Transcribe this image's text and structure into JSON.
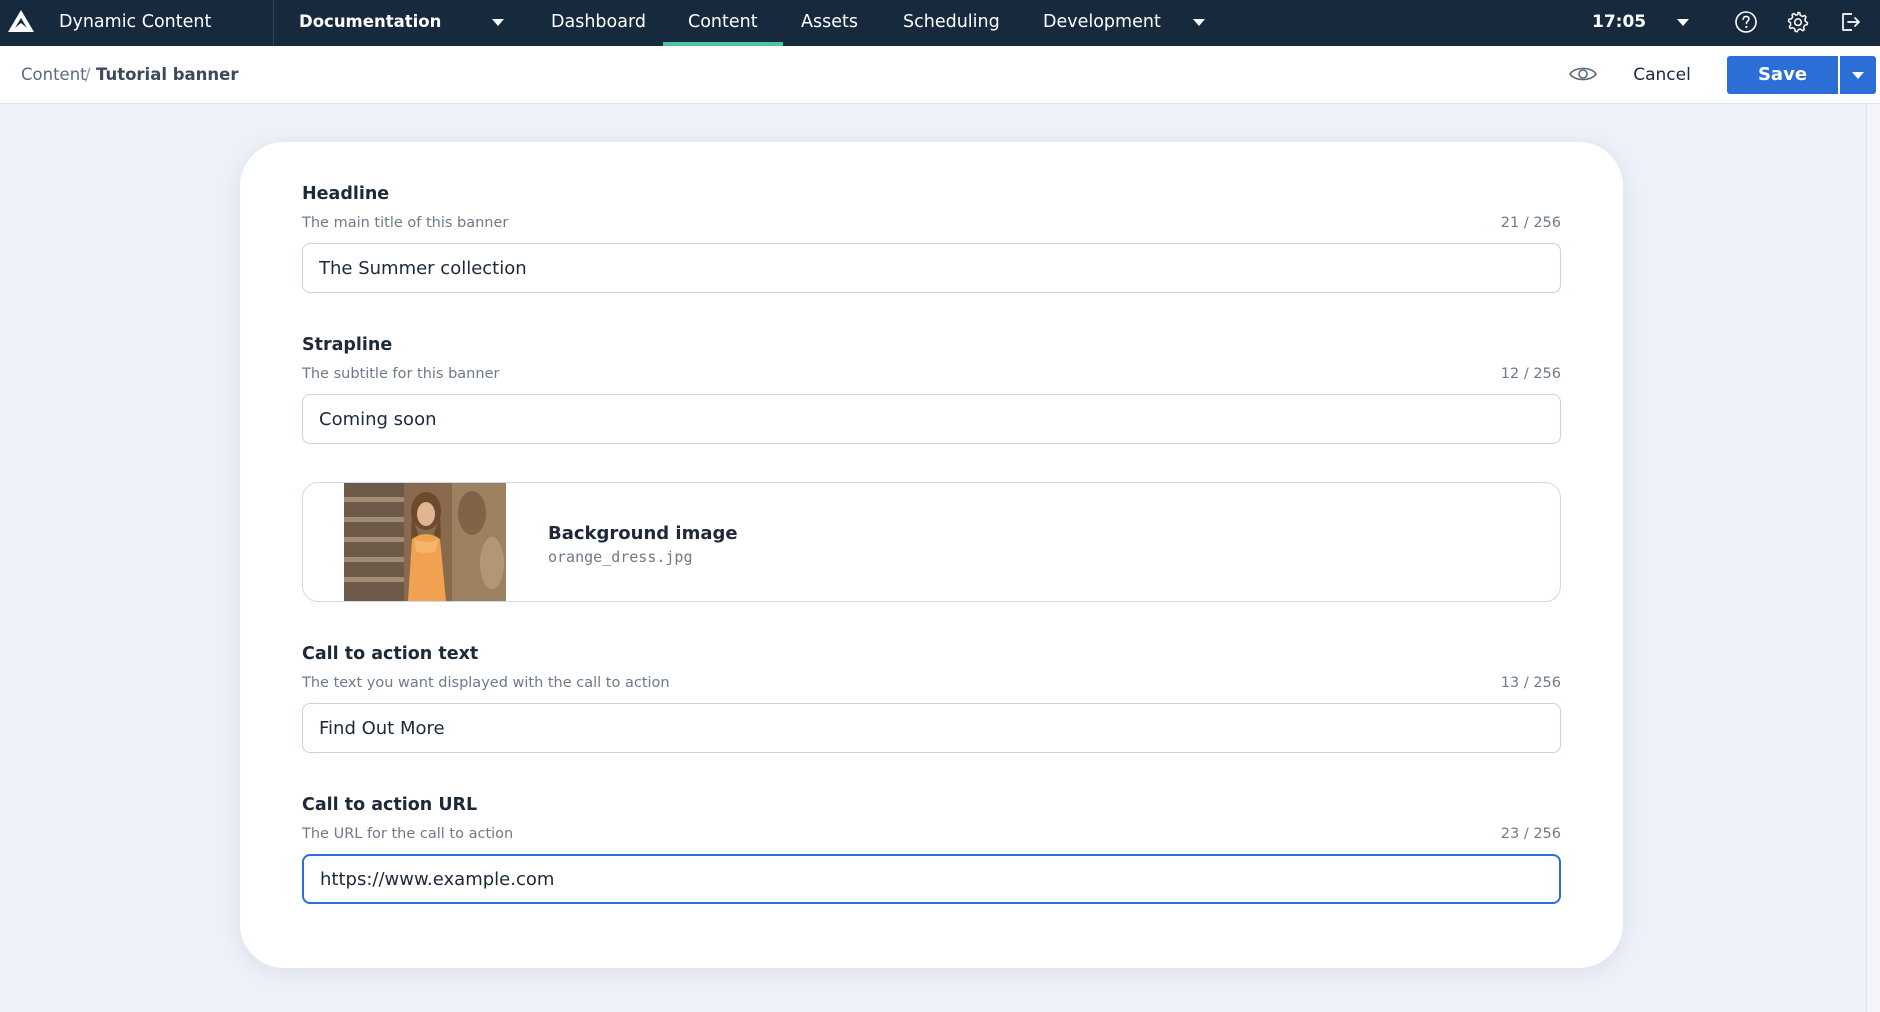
{
  "app": {
    "name": "Dynamic Content"
  },
  "hub": {
    "label": "Documentation"
  },
  "nav": {
    "items": [
      {
        "label": "Dashboard",
        "active": false
      },
      {
        "label": "Content",
        "active": true
      },
      {
        "label": "Assets",
        "active": false
      },
      {
        "label": "Scheduling",
        "active": false
      },
      {
        "label": "Development",
        "active": false
      }
    ],
    "accent_color": "#4fc3a1"
  },
  "clock": {
    "time": "17:05"
  },
  "top_icons": [
    "help-icon",
    "gear-icon",
    "logout-icon"
  ],
  "breadcrumb": {
    "root": "Content",
    "separator": "/",
    "current": "Tutorial banner"
  },
  "actions": {
    "cancel_label": "Cancel",
    "save_label": "Save",
    "primary_color": "#2b6fd6"
  },
  "form": {
    "headline": {
      "label": "Headline",
      "description": "The main title of this banner",
      "count": "21 / 256",
      "value": "The Summer collection"
    },
    "strapline": {
      "label": "Strapline",
      "description": "The subtitle for this banner",
      "count": "12 / 256",
      "value": "Coming soon"
    },
    "background_image": {
      "label": "Background image",
      "filename": "orange_dress.jpg"
    },
    "cta_text": {
      "label": "Call to action text",
      "description": "The text you want displayed with the call to action",
      "count": "13 / 256",
      "value": "Find Out More"
    },
    "cta_url": {
      "label": "Call to action URL",
      "description": "The URL for the call to action",
      "count": "23 / 256",
      "value": "https://www.example.com"
    }
  }
}
